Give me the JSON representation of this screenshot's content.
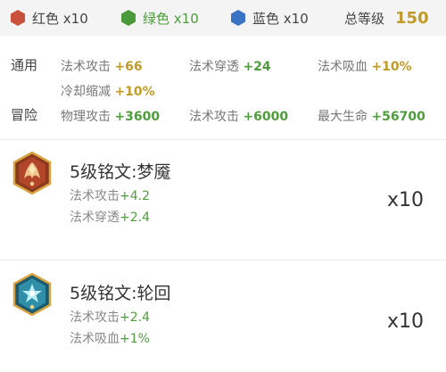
{
  "summary": {
    "gems": [
      {
        "label": "红色 x10",
        "color": "#c9503c"
      },
      {
        "label": "绿色 x10",
        "color": "#4a9a3a"
      },
      {
        "label": "蓝色 x10",
        "color": "#3a72c4"
      }
    ],
    "total_label": "总等级",
    "total_value": "150"
  },
  "stats": {
    "general": {
      "label": "通用",
      "items": [
        {
          "name": "法术攻击",
          "value": "+66"
        },
        {
          "name": "法术穿透",
          "value": "+24"
        },
        {
          "name": "法术吸血",
          "value": "+10%"
        },
        {
          "name": "冷却缩减",
          "value": "+10%"
        }
      ]
    },
    "adventure": {
      "label": "冒险",
      "items": [
        {
          "name": "物理攻击",
          "value": "+3600"
        },
        {
          "name": "法术攻击",
          "value": "+6000"
        },
        {
          "name": "最大生命",
          "value": "+56700"
        }
      ]
    }
  },
  "runes": [
    {
      "name": "5级铭文:梦魇",
      "attrs": [
        {
          "name": "法术攻击",
          "value": "+4.2"
        },
        {
          "name": "法术穿透",
          "value": "+2.4"
        }
      ],
      "count": "x10",
      "icon": "red-rune-icon"
    },
    {
      "name": "5级铭文:轮回",
      "attrs": [
        {
          "name": "法术攻击",
          "value": "+2.4"
        },
        {
          "name": "法术吸血",
          "value": "+1%"
        }
      ],
      "count": "x10",
      "icon": "blue-rune-icon"
    }
  ]
}
